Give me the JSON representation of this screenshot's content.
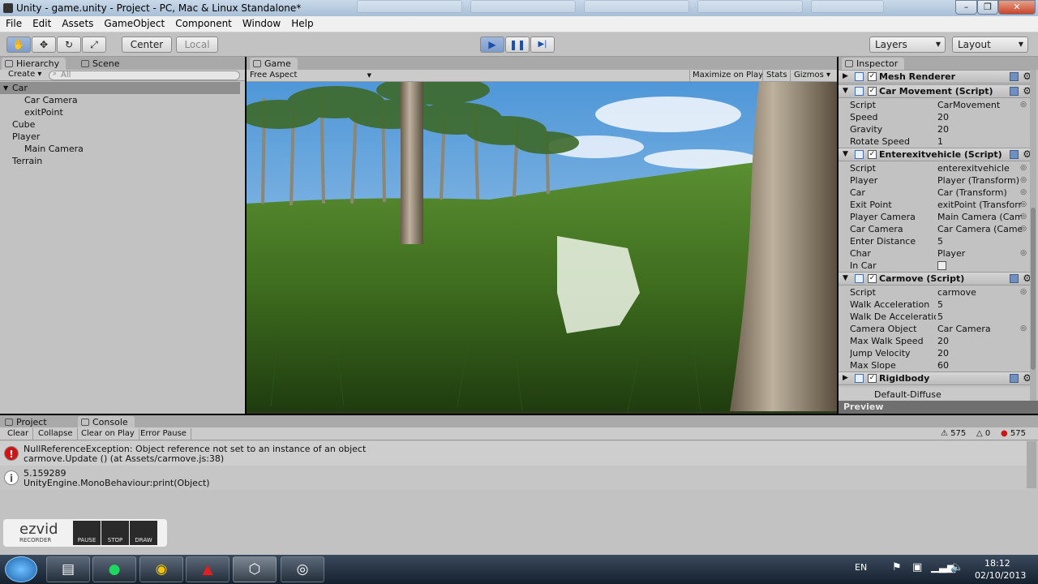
{
  "window": {
    "title": "Unity - game.unity - Project - PC, Mac & Linux Standalone*",
    "min": "–",
    "max": "❐",
    "close": "✕"
  },
  "menu": [
    "File",
    "Edit",
    "Assets",
    "GameObject",
    "Component",
    "Window",
    "Help"
  ],
  "toolbar": {
    "hand": "✋",
    "move": "✥",
    "rotate": "↻",
    "scale": "⤢",
    "center": "Center",
    "local": "Local",
    "play": "▶",
    "pause": "❚❚",
    "step": "▶|",
    "layers": "Layers",
    "layout": "Layout"
  },
  "hierarchy": {
    "tab": "Hierarchy",
    "scene_tab": "Scene",
    "create": "Create ▾",
    "search_placeholder": "All",
    "items": [
      {
        "label": "Car",
        "indent": 0,
        "selected": true
      },
      {
        "label": "Car Camera",
        "indent": 1,
        "selected": false
      },
      {
        "label": "exitPoint",
        "indent": 1,
        "selected": false
      },
      {
        "label": "Cube",
        "indent": 0,
        "selected": false
      },
      {
        "label": "Player",
        "indent": 0,
        "selected": false
      },
      {
        "label": "Main Camera",
        "indent": 1,
        "selected": false
      },
      {
        "label": "Terrain",
        "indent": 0,
        "selected": false
      }
    ]
  },
  "game": {
    "tab": "Game",
    "aspect": "Free Aspect",
    "maximize": "Maximize on Play",
    "stats": "Stats",
    "gizmos": "Gizmos ▾"
  },
  "inspector": {
    "tab": "Inspector",
    "components": [
      {
        "name": "Mesh Renderer",
        "props": []
      },
      {
        "name": "Car Movement (Script)",
        "props": [
          {
            "k": "Script",
            "v": "CarMovement",
            "ref": true
          },
          {
            "k": "Speed",
            "v": "20",
            "ref": false
          },
          {
            "k": "Gravity",
            "v": "20",
            "ref": false
          },
          {
            "k": "Rotate Speed",
            "v": "1",
            "ref": false
          }
        ]
      },
      {
        "name": "Enterexitvehicle (Script)",
        "props": [
          {
            "k": "Script",
            "v": "enterexitvehicle",
            "ref": true
          },
          {
            "k": "Player",
            "v": "Player (Transform)",
            "ref": true
          },
          {
            "k": "Car",
            "v": "Car (Transform)",
            "ref": true
          },
          {
            "k": "Exit Point",
            "v": "exitPoint (Transform)",
            "ref": true
          },
          {
            "k": "Player Camera",
            "v": "Main Camera (Camera)",
            "ref": true
          },
          {
            "k": "Car Camera",
            "v": "Car Camera (Camera)",
            "ref": true
          },
          {
            "k": "Enter Distance",
            "v": "5",
            "ref": false
          },
          {
            "k": "Char",
            "v": "Player",
            "ref": true
          },
          {
            "k": "In Car",
            "v": "",
            "ref": false
          }
        ]
      },
      {
        "name": "Carmove (Script)",
        "props": [
          {
            "k": "Script",
            "v": "carmove",
            "ref": true
          },
          {
            "k": "Walk Acceleration",
            "v": "5",
            "ref": false
          },
          {
            "k": "Walk De Acceleration",
            "v": "5",
            "ref": false
          },
          {
            "k": "Camera Object",
            "v": "Car Camera",
            "ref": true
          },
          {
            "k": "Max Walk Speed",
            "v": "20",
            "ref": false
          },
          {
            "k": "Jump Velocity",
            "v": "20",
            "ref": false
          },
          {
            "k": "Max Slope",
            "v": "60",
            "ref": false
          }
        ]
      },
      {
        "name": "Rigidbody",
        "props": []
      }
    ],
    "material": "Default-Diffuse",
    "preview": "Preview"
  },
  "bottom": {
    "project_tab": "Project",
    "console_tab": "Console",
    "buttons": [
      "Clear",
      "Collapse",
      "Clear on Play",
      "Error Pause"
    ],
    "counts": {
      "errors_a": "575",
      "warnings": "0",
      "errors_b": "575"
    },
    "entries": [
      {
        "type": "error",
        "line1": "NullReferenceException: Object reference not set to an instance of an object",
        "line2": "carmove.Update () (at Assets/carmove.js:38)"
      },
      {
        "type": "info",
        "line1": "5.159289",
        "line2": "UnityEngine.MonoBehaviour:print(Object)"
      }
    ]
  },
  "recorder": {
    "brand": "ezvid",
    "sub": "RECORDER",
    "pause": "PAUSE",
    "stop": "STOP",
    "draw": "DRAW"
  },
  "taskbar": {
    "lang": "EN",
    "time": "18:12",
    "date": "02/10/2013"
  },
  "colors": {
    "play_blue": "#4a7fd6",
    "error_red": "#d01414"
  }
}
